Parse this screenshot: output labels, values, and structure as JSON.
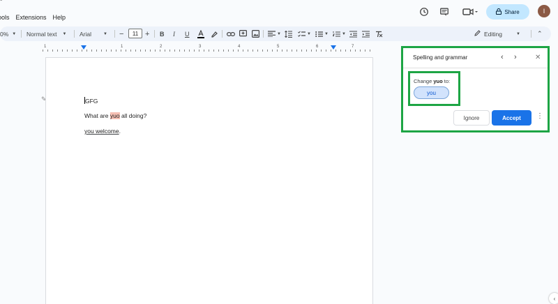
{
  "menu": {
    "crumb": "-",
    "items": [
      "ools",
      "Extensions",
      "Help"
    ]
  },
  "header": {
    "share_label": "Share",
    "avatar_initial": "I"
  },
  "toolbar": {
    "zoom": "0%",
    "style": "Normal text",
    "font": "Arial",
    "font_size": "11",
    "mode": "Editing"
  },
  "ruler": {
    "numbers": [
      "1",
      "1",
      "2",
      "3",
      "4",
      "5",
      "6",
      "7"
    ]
  },
  "document": {
    "line1": "GFG",
    "line2_before": "What are ",
    "line2_error": "yuo",
    "line2_after": " all doing?",
    "line3_error": "you welcome",
    "line3_after": "."
  },
  "spelling_panel": {
    "title": "Spelling and grammar",
    "change_prefix": "Change ",
    "change_word": "yuo",
    "change_suffix": " to:",
    "suggestion": "you",
    "ignore_label": "Ignore",
    "accept_label": "Accept"
  },
  "colors": {
    "accent": "#1a73e8",
    "share_bg": "#c2e7ff",
    "highlight_box": "#1da544",
    "error_highlight": "#f5bfb3"
  }
}
